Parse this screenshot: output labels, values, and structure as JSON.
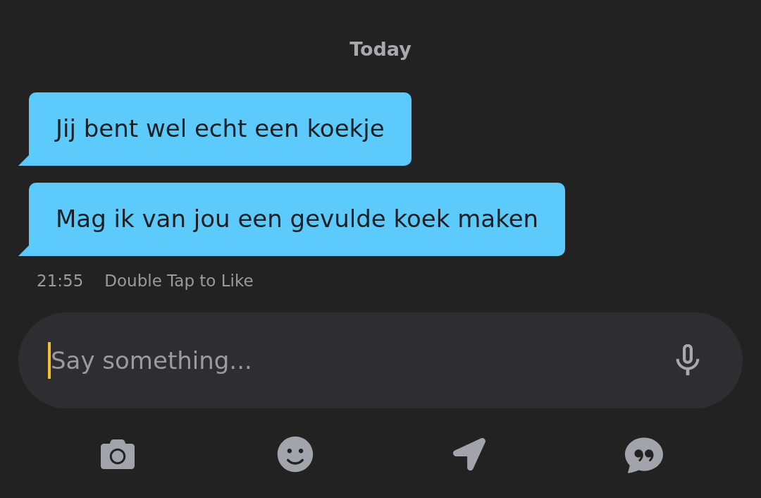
{
  "date_divider": "Today",
  "messages": [
    {
      "text": "Jij bent wel echt een koekje"
    },
    {
      "text": "Mag ik van jou een gevulde koek maken"
    }
  ],
  "message_meta": {
    "time": "21:55",
    "hint": "Double Tap to Like"
  },
  "composer": {
    "placeholder": "Say something..."
  }
}
